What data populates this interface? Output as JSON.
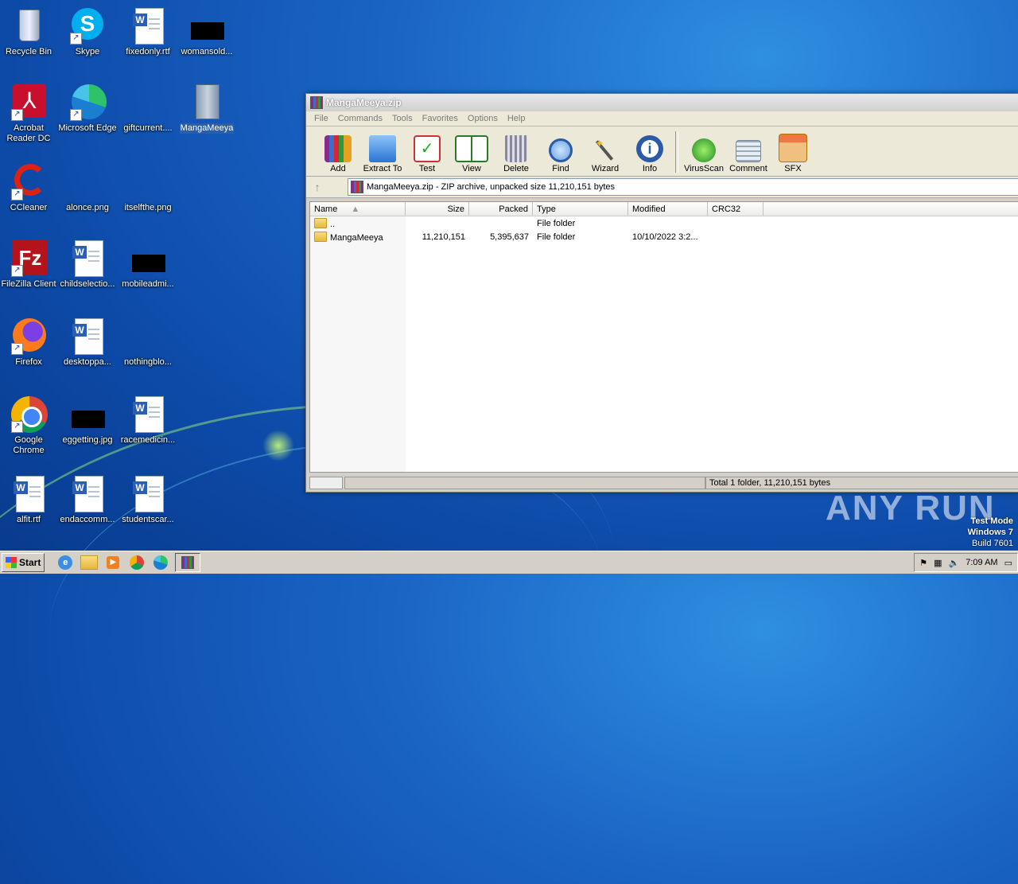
{
  "desktop": {
    "icons": [
      {
        "label": "Recycle Bin"
      },
      {
        "label": "Skype"
      },
      {
        "label": "fixedonly.rtf"
      },
      {
        "label": "womansold..."
      },
      {
        "label": "Acrobat Reader DC"
      },
      {
        "label": "Microsoft Edge"
      },
      {
        "label": "giftcurrent...."
      },
      {
        "label": "MangaMeeya"
      },
      {
        "label": "CCleaner"
      },
      {
        "label": "alonce.png"
      },
      {
        "label": "itselfthe.png"
      },
      {
        "label": "FileZilla Client"
      },
      {
        "label": "childselectio..."
      },
      {
        "label": "mobileadmi..."
      },
      {
        "label": "Firefox"
      },
      {
        "label": "desktoppa..."
      },
      {
        "label": "nothingblo..."
      },
      {
        "label": "Google Chrome"
      },
      {
        "label": "eggetting.jpg"
      },
      {
        "label": "racemedicin..."
      },
      {
        "label": "alfit.rtf"
      },
      {
        "label": "endaccomm..."
      },
      {
        "label": "studentscar..."
      }
    ]
  },
  "winrar": {
    "title": "MangaMeeya.zip",
    "menu": [
      "File",
      "Commands",
      "Tools",
      "Favorites",
      "Options",
      "Help"
    ],
    "toolbar": [
      "Add",
      "Extract To",
      "Test",
      "View",
      "Delete",
      "Find",
      "Wizard",
      "Info",
      "VirusScan",
      "Comment",
      "SFX"
    ],
    "address": "MangaMeeya.zip - ZIP archive, unpacked size 11,210,151 bytes",
    "columns": [
      "Name",
      "Size",
      "Packed",
      "Type",
      "Modified",
      "CRC32"
    ],
    "rows": [
      {
        "name": "..",
        "size": "",
        "packed": "",
        "type": "File folder",
        "modified": "",
        "crc": ""
      },
      {
        "name": "MangaMeeya",
        "size": "11,210,151",
        "packed": "5,395,637",
        "type": "File folder",
        "modified": "10/10/2022 3:2...",
        "crc": ""
      }
    ],
    "status": "Total 1 folder, 11,210,151 bytes"
  },
  "taskbar": {
    "start": "Start",
    "clock": "7:09 AM"
  },
  "overlay": {
    "watermark": "ANY RUN",
    "test_mode": "Test Mode",
    "os": "Windows 7",
    "build": "Build 7601"
  }
}
